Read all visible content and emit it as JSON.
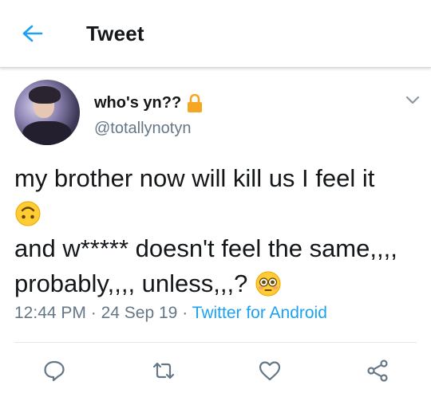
{
  "header": {
    "title": "Tweet",
    "back_icon": "back-arrow-icon"
  },
  "colors": {
    "accent": "#1da1f2",
    "text_primary": "#14171a",
    "text_secondary": "#657786",
    "lock": "#f5a623"
  },
  "tweet": {
    "display_name": "who's yn??",
    "protected_icon": "lock-icon",
    "handle": "@totallynotyn",
    "lines": [
      "my brother now will kill us I feel it",
      "and w***** doesn't feel the same,,,,",
      "probably,,,, unless,,,?"
    ],
    "emojis": [
      "upside-down-face-emoji",
      "flushed-face-emoji"
    ],
    "time": "12:44 PM",
    "separator": "·",
    "date": "24 Sep 19",
    "source": "Twitter for Android"
  },
  "actions": [
    {
      "name": "reply",
      "icon": "reply-icon"
    },
    {
      "name": "retweet",
      "icon": "retweet-icon"
    },
    {
      "name": "like",
      "icon": "heart-icon"
    },
    {
      "name": "share",
      "icon": "share-icon"
    }
  ]
}
